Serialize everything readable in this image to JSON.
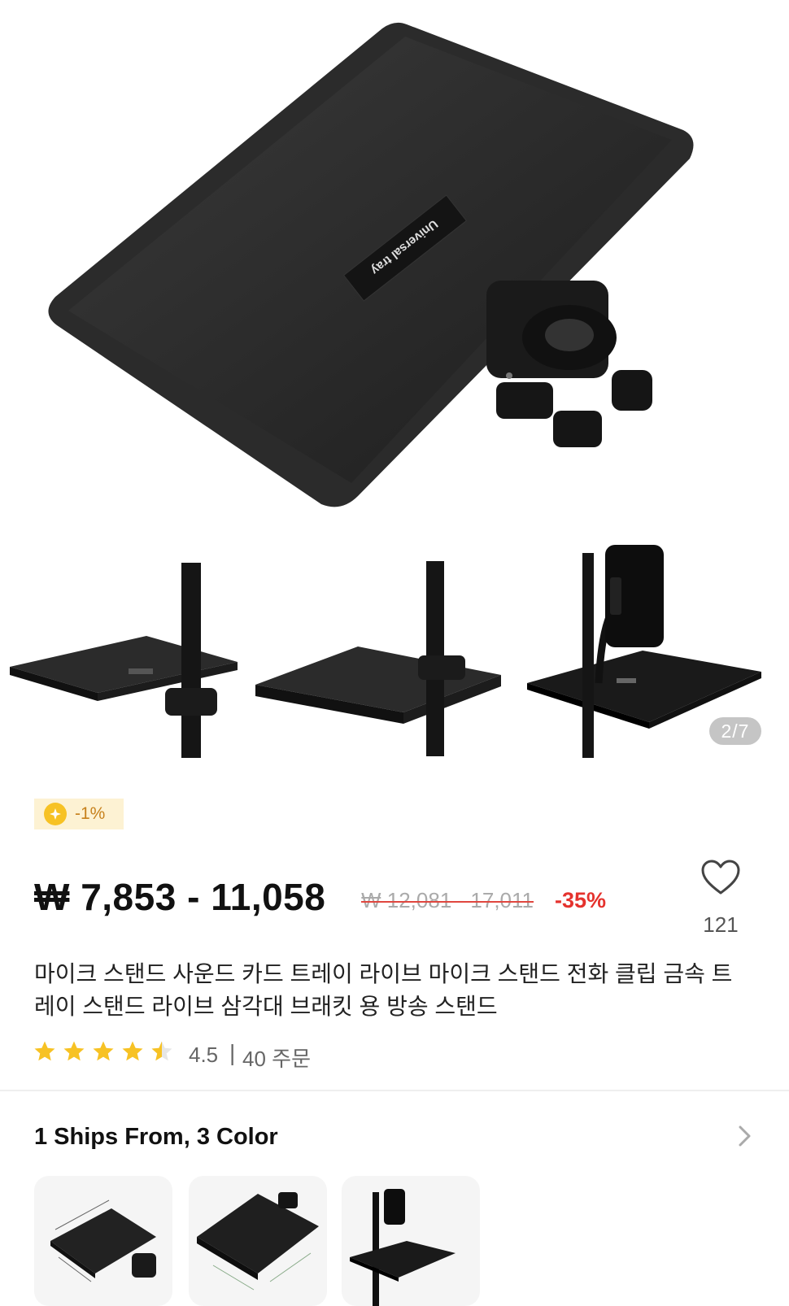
{
  "gallery": {
    "hero_label_text": "Universal tray",
    "page_counter": "2/7"
  },
  "promo": {
    "coin_discount": "-1%"
  },
  "pricing": {
    "price_range": "₩ 7,853 - 11,058",
    "original_price_range": "₩ 12,081 - 17,011",
    "discount": "-35%",
    "colors": {
      "discount": "#e5322d",
      "strike": "#e0473f",
      "coin": "#f7c224",
      "badge_bg": "#fdf2d3",
      "star": "#f7c224"
    }
  },
  "wishlist": {
    "icon": "heart-outline-icon",
    "count": "121"
  },
  "product": {
    "title": "마이크 스탠드 사운드 카드 트레이 라이브 마이크 스탠드 전화 클립 금속 트레이 스탠드 라이브 삼각대 브래킷 용 방송 스탠드",
    "rating": 4.5,
    "rating_text": "4.5",
    "rating_separator": "|",
    "orders_text": "40 주문"
  },
  "variants": {
    "label": "1 Ships From, 3 Color",
    "items": [
      "tray-with-dimensions",
      "tray-with-clamp",
      "tray-with-phone-holder"
    ]
  }
}
